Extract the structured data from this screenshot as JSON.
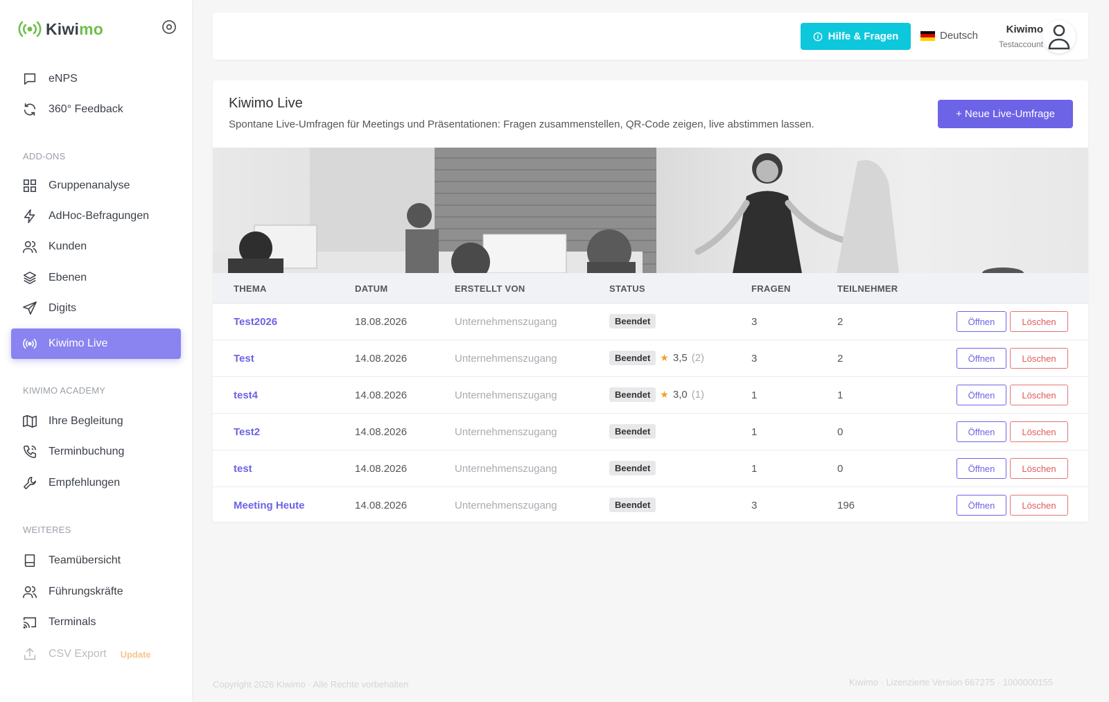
{
  "brand": {
    "part1": "Kiwi",
    "part2": "mo",
    "green": "#6fbf4a",
    "dark": "#3a3f47"
  },
  "sidebar": {
    "items_top": [
      {
        "label": "eNPS",
        "icon": "chat-icon"
      },
      {
        "label": "360° Feedback",
        "icon": "refresh-icon"
      }
    ],
    "section_addons": "ADD-ONS",
    "items_addons": [
      {
        "label": "Gruppenanalyse",
        "icon": "grid-icon"
      },
      {
        "label": "AdHoc-Befragungen",
        "icon": "bolt-icon"
      },
      {
        "label": "Kunden",
        "icon": "users-icon"
      },
      {
        "label": "Ebenen",
        "icon": "layers-icon"
      },
      {
        "label": "Digits",
        "icon": "send-icon"
      },
      {
        "label": "Kiwimo Live",
        "icon": "broadcast-icon",
        "active": true
      }
    ],
    "section_academy": "KIWIMO ACADEMY",
    "items_academy": [
      {
        "label": "Ihre Begleitung",
        "icon": "map-icon"
      },
      {
        "label": "Terminbuchung",
        "icon": "phone-icon"
      },
      {
        "label": "Empfehlungen",
        "icon": "wrench-icon"
      }
    ],
    "section_more": "WEITERES",
    "items_more": [
      {
        "label": "Teamübersicht",
        "icon": "book-icon"
      },
      {
        "label": "Führungskräfte",
        "icon": "users-icon"
      },
      {
        "label": "Terminals",
        "icon": "cast-icon"
      },
      {
        "label": "CSV Export",
        "icon": "upload-icon",
        "badge": "Update"
      }
    ],
    "active_color": "#8a84f0"
  },
  "topbar": {
    "help_label": "Hilfe & Fragen",
    "help_color": "#0dc7dc",
    "language": "Deutsch",
    "user_name": "Kiwimo",
    "user_sub": "Testaccount"
  },
  "main": {
    "title": "Kiwimo Live",
    "description": "Spontane Live-Umfragen für Meetings und Präsentationen: Fragen zusammenstellen, QR-Code zeigen, live abstimmen lassen.",
    "new_button": "+ Neue Live-Umfrage",
    "accent_color": "#6c63e6"
  },
  "table": {
    "headers": [
      "THEMA",
      "DATUM",
      "ERSTELLT VON",
      "STATUS",
      "FRAGEN",
      "TEILNEHMER"
    ],
    "open_label": "Öffnen",
    "delete_label": "Löschen",
    "rows": [
      {
        "theme": "Test2026",
        "date": "18.08.2026",
        "creator": "Unternehmenszugang",
        "status": "Beendet",
        "rating": "",
        "rating_count": "",
        "questions": "3",
        "participants": "2"
      },
      {
        "theme": "Test",
        "date": "14.08.2026",
        "creator": "Unternehmenszugang",
        "status": "Beendet",
        "rating": "3,5",
        "rating_count": "(2)",
        "questions": "3",
        "participants": "2"
      },
      {
        "theme": "test4",
        "date": "14.08.2026",
        "creator": "Unternehmenszugang",
        "status": "Beendet",
        "rating": "3,0",
        "rating_count": "(1)",
        "questions": "1",
        "participants": "1"
      },
      {
        "theme": "Test2",
        "date": "14.08.2026",
        "creator": "Unternehmenszugang",
        "status": "Beendet",
        "rating": "",
        "rating_count": "",
        "questions": "1",
        "participants": "0"
      },
      {
        "theme": "test",
        "date": "14.08.2026",
        "creator": "Unternehmenszugang",
        "status": "Beendet",
        "rating": "",
        "rating_count": "",
        "questions": "1",
        "participants": "0"
      },
      {
        "theme": "Meeting Heute",
        "date": "14.08.2026",
        "creator": "Unternehmenszugang",
        "status": "Beendet",
        "rating": "",
        "rating_count": "",
        "questions": "3",
        "participants": "196"
      }
    ]
  },
  "footer": {
    "left": "Copyright 2026 Kiwimo · Alle Rechte vorbehalten",
    "right": "Kiwimo · Lizenzierte Version 667275 · 1000000155"
  }
}
